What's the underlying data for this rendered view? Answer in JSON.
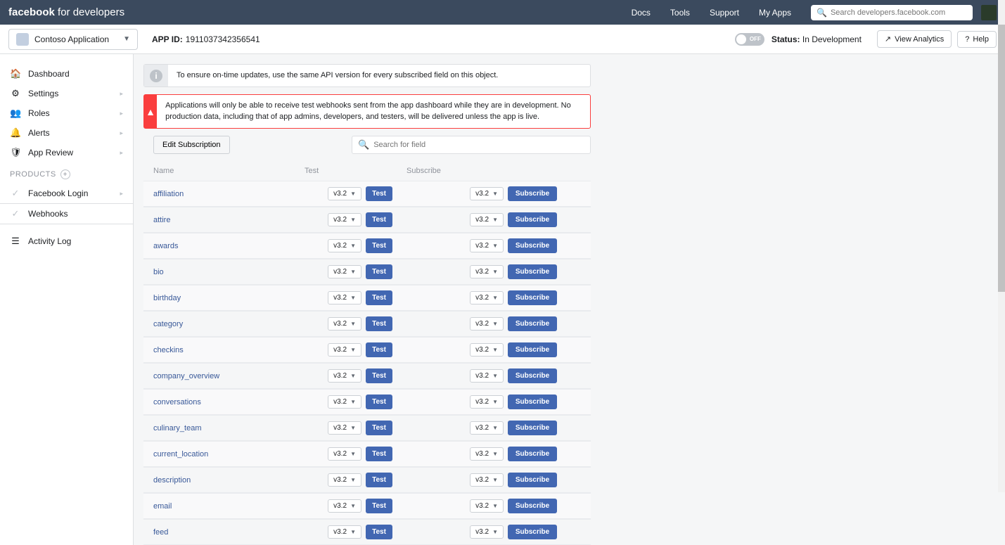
{
  "topnav": {
    "brand_bold": "facebook",
    "brand_rest": " for developers",
    "links": [
      "Docs",
      "Tools",
      "Support",
      "My Apps"
    ],
    "search_placeholder": "Search developers.facebook.com"
  },
  "subheader": {
    "app_name": "Contoso Application",
    "appid_label": "APP ID:",
    "appid_value": "1911037342356541",
    "toggle_text": "OFF",
    "status_label": "Status:",
    "status_value": "In Development",
    "view_analytics": "View Analytics",
    "help": "Help"
  },
  "sidebar": {
    "items": [
      {
        "icon": "🏠",
        "label": "Dashboard",
        "chev": false
      },
      {
        "icon": "⚙",
        "label": "Settings",
        "chev": true
      },
      {
        "icon": "👥",
        "label": "Roles",
        "chev": true
      },
      {
        "icon": "🔔",
        "label": "Alerts",
        "chev": true
      },
      {
        "icon": "🛡",
        "label": "App Review",
        "chev": true
      }
    ],
    "products_label": "PRODUCTS",
    "products": [
      {
        "label": "Facebook Login",
        "chev": true,
        "active": false
      },
      {
        "label": "Webhooks",
        "chev": false,
        "active": true
      }
    ],
    "activity_log": "Activity Log"
  },
  "alerts": {
    "info": "To ensure on-time updates, use the same API version for every subscribed field on this object.",
    "warn": "Applications will only be able to receive test webhooks sent from the app dashboard while they are in development. No production data, including that of app admins, developers, and testers, will be delivered unless the app is live."
  },
  "toolbar": {
    "edit_subscription": "Edit Subscription",
    "field_search_placeholder": "Search for field"
  },
  "table": {
    "headers": {
      "name": "Name",
      "test": "Test",
      "subscribe": "Subscribe"
    },
    "version": "v3.2",
    "test_label": "Test",
    "subscribe_label": "Subscribe",
    "fields": [
      "affiliation",
      "attire",
      "awards",
      "bio",
      "birthday",
      "category",
      "checkins",
      "company_overview",
      "conversations",
      "culinary_team",
      "current_location",
      "description",
      "email",
      "feed"
    ]
  }
}
